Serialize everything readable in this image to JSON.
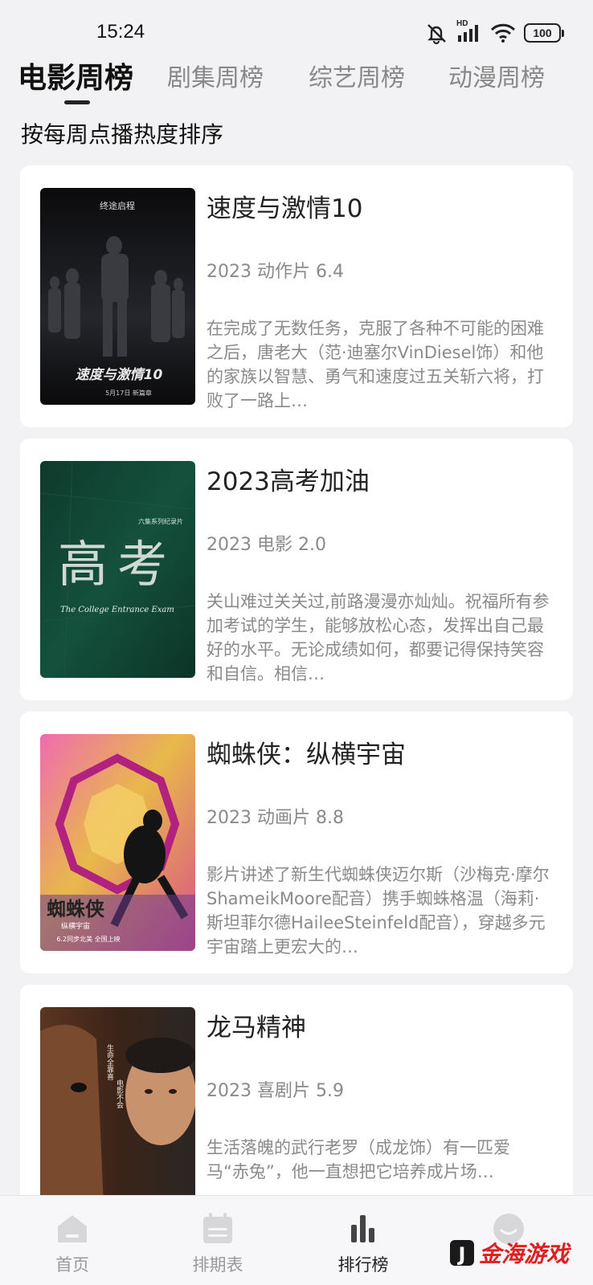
{
  "status_bar": {
    "time": "15:24",
    "signal_label": "HD",
    "battery": "100",
    "icons": [
      "mute-bell-icon",
      "signal-icon",
      "wifi-icon",
      "battery-icon"
    ]
  },
  "tabs": [
    {
      "label": "电影周榜",
      "active": true
    },
    {
      "label": "剧集周榜",
      "active": false
    },
    {
      "label": "综艺周榜",
      "active": false
    },
    {
      "label": "动漫周榜",
      "active": false
    }
  ],
  "subtitle": "按每周点播热度排序",
  "items": [
    {
      "title": "速度与激情10",
      "meta": "2023 动作片 6.4",
      "description": "在完成了无数任务，克服了各种不可能的困难之后，唐老大（范·迪塞尔VinDiesel饰）和他的家族以智慧、勇气和速度过五关斩六将，打败了一路上…",
      "poster": {
        "top_text": "终途启程",
        "title_text": "速度与激情10",
        "date_text": "5月17日 新篇章"
      }
    },
    {
      "title": "2023高考加油",
      "meta": "2023 电影 2.0",
      "description": "关山难过关关过,前路漫漫亦灿灿。祝福所有参加考试的学生，能够放松心态，发挥出自己最好的水平。无论成绩如何，都要记得保持笑容和自信。相信…",
      "poster": {
        "top_text": "六集系列纪录片",
        "title_text": "高考",
        "sub_text": "The College Entrance Exam"
      }
    },
    {
      "title": "蜘蛛侠：纵横宇宙",
      "meta": "2023 动画片 8.8",
      "description": "影片讲述了新生代蜘蛛侠迈尔斯（沙梅克·摩尔ShameikMoore配音）携手蜘蛛格温（海莉·斯坦菲尔德HaileeSteinfeld配音），穿越多元宇宙踏上更宏大的…",
      "poster": {
        "title_text": "蜘蛛侠",
        "sub_text": "纵横宇宙",
        "date_text": "6.2同步北美 全国上映"
      }
    },
    {
      "title": "龙马精神",
      "meta": "2023 喜剧片 5.9",
      "description": "生活落魄的武行老罗（成龙饰）有一匹爱马“赤兔”，他一直想把它培养成片场…",
      "poster": {
        "tagline_1": "生命全靠喜",
        "tagline_2": "电影不会"
      }
    }
  ],
  "bottom_nav": [
    {
      "label": "首页",
      "icon": "home-icon",
      "active": false
    },
    {
      "label": "排期表",
      "icon": "schedule-icon",
      "active": false
    },
    {
      "label": "排行榜",
      "icon": "chart-icon",
      "active": true
    },
    {
      "label": "",
      "icon": "smiley-icon",
      "active": false
    }
  ],
  "watermark": {
    "text": "金海游戏",
    "logo_letter": "J"
  }
}
